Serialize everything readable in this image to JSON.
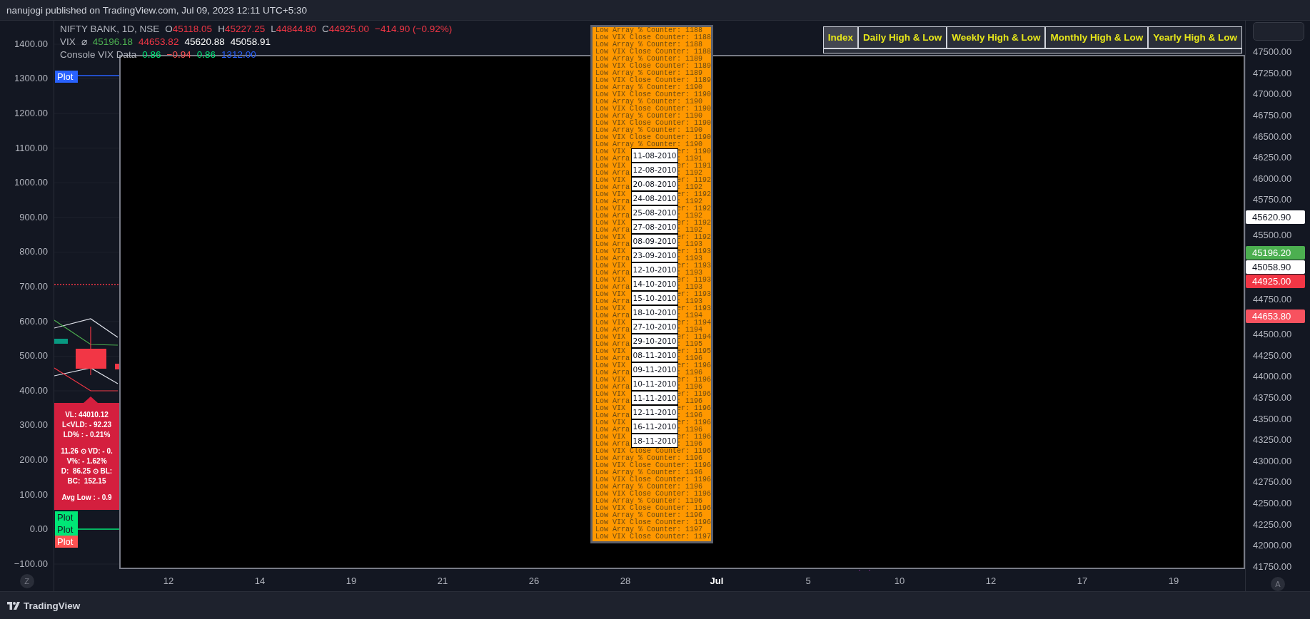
{
  "header": {
    "text": "nanujogi published on TradingView.com, Jul 09, 2023 12:11 UTC+5:30"
  },
  "legend": [
    {
      "title": "NIFTY BANK, 1D, NSE",
      "values": [
        {
          "prefix": "O",
          "text": "45118.05",
          "color": "#f23645"
        },
        {
          "prefix": "H",
          "text": "45227.25",
          "color": "#f23645"
        },
        {
          "prefix": "L",
          "text": "44844.80",
          "color": "#f23645"
        },
        {
          "prefix": "C",
          "text": "44925.00",
          "color": "#f23645"
        },
        {
          "text": "−414.90 (−0.92%)",
          "color": "#f23645"
        }
      ]
    },
    {
      "title": "VIX",
      "glyph": "⌀",
      "values": [
        {
          "text": "45196.18",
          "color": "#4caf50"
        },
        {
          "text": "44653.82",
          "color": "#f23645"
        },
        {
          "text": "45620.88",
          "color": "#ffffff"
        },
        {
          "text": "45058.91",
          "color": "#ffffff"
        }
      ]
    },
    {
      "title": "Console VIX Data",
      "values": [
        {
          "text": "0.86",
          "color": "#00e676"
        },
        {
          "text": "−0.94",
          "color": "#ff5252"
        },
        {
          "text": "0.86",
          "color": "#00e676"
        },
        {
          "text": "1312.00",
          "color": "#2962ff"
        }
      ]
    }
  ],
  "left_axis": [
    "1400.00",
    "1300.00",
    "1200.00",
    "1100.00",
    "1000.00",
    "900.00",
    "800.00",
    "700.00",
    "600.00",
    "500.00",
    "400.00",
    "300.00",
    "200.00",
    "100.00",
    "0.00",
    "−100.00"
  ],
  "right_axis": [
    {
      "kind": "tick",
      "text": "47500.00"
    },
    {
      "kind": "tick",
      "text": "47250.00"
    },
    {
      "kind": "tick",
      "text": "47000.00"
    },
    {
      "kind": "tick",
      "text": "46750.00"
    },
    {
      "kind": "tick",
      "text": "46500.00"
    },
    {
      "kind": "tick",
      "text": "46250.00"
    },
    {
      "kind": "tick",
      "text": "46000.00"
    },
    {
      "kind": "tick",
      "text": "45750.00"
    },
    {
      "kind": "tag",
      "text": "45620.90",
      "color": "#ffffff"
    },
    {
      "kind": "tick",
      "text": "45500.00"
    },
    {
      "kind": "tag",
      "text": "45196.20",
      "color": "#4caf50"
    },
    {
      "kind": "tag",
      "text": "45058.90",
      "color": "#ffffff"
    },
    {
      "kind": "tag",
      "text": "44925.00",
      "color": "#f23645"
    },
    {
      "kind": "tick",
      "text": "44750.00"
    },
    {
      "kind": "tag",
      "text": "44653.80",
      "color": "#f7525f"
    },
    {
      "kind": "tick",
      "text": "44500.00"
    },
    {
      "kind": "tick",
      "text": "44250.00"
    },
    {
      "kind": "tick",
      "text": "44000.00"
    },
    {
      "kind": "tick",
      "text": "43750.00"
    },
    {
      "kind": "tick",
      "text": "43500.00"
    },
    {
      "kind": "tick",
      "text": "43250.00"
    },
    {
      "kind": "tick",
      "text": "43000.00"
    },
    {
      "kind": "tick",
      "text": "42750.00"
    },
    {
      "kind": "tick",
      "text": "42500.00"
    },
    {
      "kind": "tick",
      "text": "42250.00"
    },
    {
      "kind": "tick",
      "text": "42000.00"
    },
    {
      "kind": "tick",
      "text": "41750.00"
    }
  ],
  "time_axis": [
    {
      "kind": "day",
      "text": "12"
    },
    {
      "kind": "day",
      "text": "14"
    },
    {
      "kind": "day",
      "text": "19"
    },
    {
      "kind": "day",
      "text": "21"
    },
    {
      "kind": "day",
      "text": "26"
    },
    {
      "kind": "day",
      "text": "28"
    },
    {
      "kind": "month",
      "text": "Jul"
    },
    {
      "kind": "day",
      "text": "5"
    },
    {
      "kind": "day",
      "text": "10"
    },
    {
      "kind": "day",
      "text": "12"
    },
    {
      "kind": "day",
      "text": "17"
    },
    {
      "kind": "day",
      "text": "19"
    }
  ],
  "plot_tags": [
    {
      "text": "Plot",
      "color": "#2962ff"
    }
  ],
  "plot_stack": [
    {
      "text": "Plot",
      "color": "#00e676"
    },
    {
      "text": "Plot",
      "color": "#00e676"
    },
    {
      "text": "Plot",
      "color": "#ff5252"
    }
  ],
  "info_box": {
    "groups": [
      [
        "VL: 44010.12",
        "L<VLD: - 92.23",
        "LD% : - 0.21%"
      ],
      [
        "11.26 ⊙ VD: - 0.",
        "V%: - 1.62%",
        "D:  86.25 ⊙ BL:",
        "BC:  152.15"
      ],
      [
        "Avg Low : - 0.9"
      ]
    ]
  },
  "table": {
    "columns": [
      "Index",
      "Daily High & Low",
      "Weekly High & Low",
      "Monthly High & Low",
      "Yearly High & Low"
    ]
  },
  "log_lines": [
    {
      "kind": "full",
      "text": "Low Array % Counter: 1188"
    },
    {
      "kind": "full",
      "text": "Low VIX Close Counter: 1188"
    },
    {
      "kind": "full",
      "text": "Low Array % Counter: 1188"
    },
    {
      "kind": "full",
      "text": "Low VIX Close Counter: 1188"
    },
    {
      "kind": "full",
      "text": "Low Array % Counter: 1189"
    },
    {
      "kind": "full",
      "text": "Low VIX Close Counter: 1189"
    },
    {
      "kind": "full",
      "text": "Low Array % Counter: 1189"
    },
    {
      "kind": "full",
      "text": "Low VIX Close Counter: 1189"
    },
    {
      "kind": "full",
      "text": "Low Array % Counter: 1190"
    },
    {
      "kind": "full",
      "text": "Low VIX Close Counter: 1190"
    },
    {
      "kind": "full",
      "text": "Low Array % Counter: 1190"
    },
    {
      "kind": "full",
      "text": "Low VIX Close Counter: 1190"
    },
    {
      "kind": "full",
      "text": "Low Array % Counter: 1190"
    },
    {
      "kind": "full",
      "text": "Low VIX Close Counter: 1190"
    },
    {
      "kind": "full",
      "text": "Low Array % Counter: 1190"
    },
    {
      "kind": "full",
      "text": "Low VIX Close Counter: 1190"
    },
    {
      "kind": "full",
      "text": "Low Array % Counter: 1190"
    },
    {
      "kind": "split",
      "left": "Low VIX",
      "right": "er: 1190"
    },
    {
      "kind": "split",
      "left": "Low Arra",
      "right": ": 1191"
    },
    {
      "kind": "split",
      "left": "Low VIX",
      "right": "er: 1191"
    },
    {
      "kind": "split",
      "left": "Low Arra",
      "right": ": 1192"
    },
    {
      "kind": "split",
      "left": "Low VIX",
      "right": "er: 1192"
    },
    {
      "kind": "split",
      "left": "Low Arra",
      "right": ": 1192"
    },
    {
      "kind": "split",
      "left": "Low VIX",
      "right": "er: 1192"
    },
    {
      "kind": "split",
      "left": "Low Arra",
      "right": ": 1192"
    },
    {
      "kind": "split",
      "left": "Low VIX",
      "right": "er: 1192"
    },
    {
      "kind": "split",
      "left": "Low Arra",
      "right": ": 1192"
    },
    {
      "kind": "split",
      "left": "Low VIX",
      "right": "er: 1192"
    },
    {
      "kind": "split",
      "left": "Low Arra",
      "right": ": 1192"
    },
    {
      "kind": "split",
      "left": "Low VIX",
      "right": "er: 1192"
    },
    {
      "kind": "split",
      "left": "Low Arra",
      "right": ": 1193"
    },
    {
      "kind": "split",
      "left": "Low VIX",
      "right": "er: 1193"
    },
    {
      "kind": "split",
      "left": "Low Arra",
      "right": ": 1193"
    },
    {
      "kind": "split",
      "left": "Low VIX",
      "right": "er: 1193"
    },
    {
      "kind": "split",
      "left": "Low Arra",
      "right": ": 1193"
    },
    {
      "kind": "split",
      "left": "Low VIX",
      "right": "er: 1193"
    },
    {
      "kind": "split",
      "left": "Low Arra",
      "right": ": 1193"
    },
    {
      "kind": "split",
      "left": "Low VIX",
      "right": "er: 1193"
    },
    {
      "kind": "split",
      "left": "Low Arra",
      "right": ": 1193"
    },
    {
      "kind": "split",
      "left": "Low VIX",
      "right": "er: 1193"
    },
    {
      "kind": "split",
      "left": "Low Arra",
      "right": ": 1194"
    },
    {
      "kind": "split",
      "left": "Low VIX",
      "right": "er: 1194"
    },
    {
      "kind": "split",
      "left": "Low Arra",
      "right": ": 1194"
    },
    {
      "kind": "split",
      "left": "Low VIX",
      "right": "er: 1194"
    },
    {
      "kind": "split",
      "left": "Low Arra",
      "right": ": 1195"
    },
    {
      "kind": "split",
      "left": "Low VIX",
      "right": "er: 1195"
    },
    {
      "kind": "split",
      "left": "Low Arra",
      "right": ": 1196"
    },
    {
      "kind": "split",
      "left": "Low VIX",
      "right": "er: 1196"
    },
    {
      "kind": "split",
      "left": "Low Arra",
      "right": ": 1196"
    },
    {
      "kind": "split",
      "left": "Low VIX",
      "right": "er: 1196"
    },
    {
      "kind": "split",
      "left": "Low Arra",
      "right": ": 1196"
    },
    {
      "kind": "split",
      "left": "Low VIX",
      "right": "er: 1196"
    },
    {
      "kind": "split",
      "left": "Low Arra",
      "right": ": 1196"
    },
    {
      "kind": "split",
      "left": "Low VIX",
      "right": "er: 1196"
    },
    {
      "kind": "split",
      "left": "Low Arra",
      "right": ": 1196"
    },
    {
      "kind": "split",
      "left": "Low VIX",
      "right": "er: 1196"
    },
    {
      "kind": "split",
      "left": "Low Arra",
      "right": ": 1196"
    },
    {
      "kind": "split",
      "left": "Low VIX",
      "right": "er: 1196"
    },
    {
      "kind": "split",
      "left": "Low Arra",
      "right": ": 1196"
    },
    {
      "kind": "full",
      "text": "Low VIX Close Counter: 1196"
    },
    {
      "kind": "full",
      "text": "Low Array % Counter: 1196"
    },
    {
      "kind": "full",
      "text": "Low VIX Close Counter: 1196"
    },
    {
      "kind": "full",
      "text": "Low Array % Counter: 1196"
    },
    {
      "kind": "full",
      "text": "Low VIX Close Counter: 1196"
    },
    {
      "kind": "full",
      "text": "Low Array % Counter: 1196"
    },
    {
      "kind": "full",
      "text": "Low VIX Close Counter: 1196"
    },
    {
      "kind": "full",
      "text": "Low Array % Counter: 1196"
    },
    {
      "kind": "full",
      "text": "Low VIX Close Counter: 1196"
    },
    {
      "kind": "full",
      "text": "Low Array % Counter: 1196"
    },
    {
      "kind": "full",
      "text": "Low VIX Close Counter: 1196"
    },
    {
      "kind": "full",
      "text": "Low Array % Counter: 1197"
    },
    {
      "kind": "full",
      "text": "Low VIX Close Counter: 1197"
    }
  ],
  "dates": [
    "11-08-2010",
    "12-08-2010",
    "20-08-2010",
    "24-08-2010",
    "25-08-2010",
    "27-08-2010",
    "08-09-2010",
    "23-09-2010",
    "12-10-2010",
    "14-10-2010",
    "15-10-2010",
    "18-10-2010",
    "27-10-2010",
    "29-10-2010",
    "08-11-2010",
    "09-11-2010",
    "10-11-2010",
    "11-11-2010",
    "12-11-2010",
    "16-11-2010",
    "18-11-2010"
  ],
  "corner_buttons": {
    "left": "Z",
    "right": "A"
  },
  "footer": {
    "brand": "TradingView"
  }
}
